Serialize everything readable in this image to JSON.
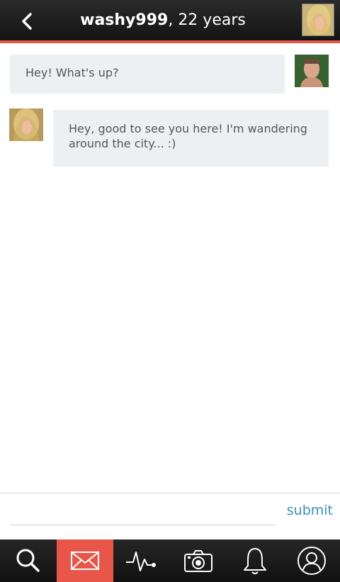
{
  "header": {
    "username": "washy999",
    "age_text": ", 22 years",
    "back_icon": "chevron-left-icon"
  },
  "messages": [
    {
      "direction": "sent",
      "text": "Hey! What's up?"
    },
    {
      "direction": "received",
      "text": "Hey, good to see you here! I'm wandering around the city... :)"
    }
  ],
  "composer": {
    "value": "",
    "submit_label": "submit"
  },
  "tabbar": {
    "items": [
      {
        "icon": "search-icon",
        "active": false
      },
      {
        "icon": "mail-icon",
        "active": true
      },
      {
        "icon": "activity-icon",
        "active": false
      },
      {
        "icon": "camera-icon",
        "active": false
      },
      {
        "icon": "bell-icon",
        "active": false
      },
      {
        "icon": "profile-icon",
        "active": false
      }
    ]
  },
  "colors": {
    "accent": "#e8564a",
    "link": "#3d8fb8",
    "bubble": "#edf0f2",
    "bar": "#1c1c1c"
  }
}
